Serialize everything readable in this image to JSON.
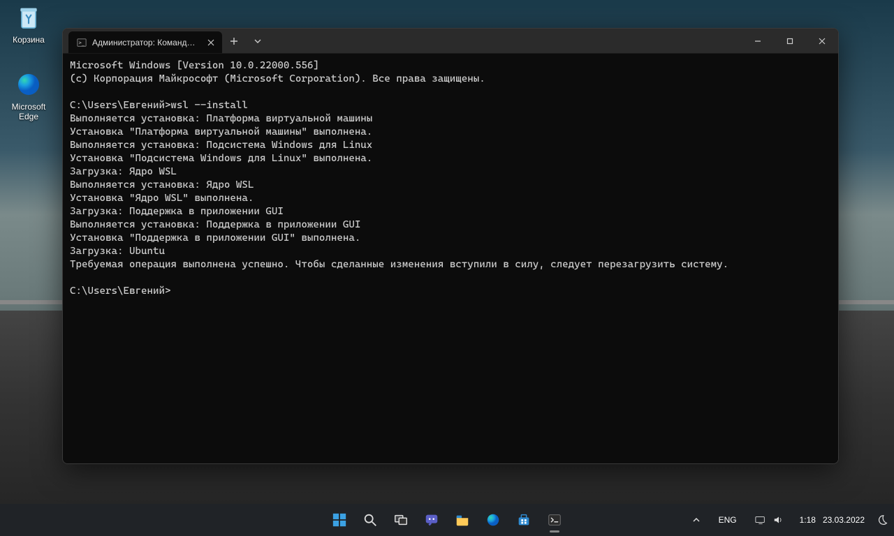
{
  "desktop": {
    "recycle_label": "Корзина",
    "edge_label": "Microsoft Edge"
  },
  "window": {
    "tab_title": "Администратор: Командная ст",
    "lines": [
      "Microsoft Windows [Version 10.0.22000.556]",
      "(c) Корпорация Майкрософт (Microsoft Corporation). Все права защищены.",
      "",
      "C:\\Users\\Евгений>wsl --install",
      "Выполняется установка: Платформа виртуальной машины",
      "Установка \"Платформа виртуальной машины\" выполнена.",
      "Выполняется установка: Подсистема Windows для Linux",
      "Установка \"Подсистема Windows для Linux\" выполнена.",
      "Загрузка: Ядро WSL",
      "Выполняется установка: Ядро WSL",
      "Установка \"Ядро WSL\" выполнена.",
      "Загрузка: Поддержка в приложении GUI",
      "Выполняется установка: Поддержка в приложении GUI",
      "Установка \"Поддержка в приложении GUI\" выполнена.",
      "Загрузка: Ubuntu",
      "Требуемая операция выполнена успешно. Чтобы сделанные изменения вступили в силу, следует перезагрузить систему.",
      "",
      "C:\\Users\\Евгений>"
    ]
  },
  "taskbar": {
    "language": "ENG",
    "time": "1:18",
    "date": "23.03.2022"
  }
}
